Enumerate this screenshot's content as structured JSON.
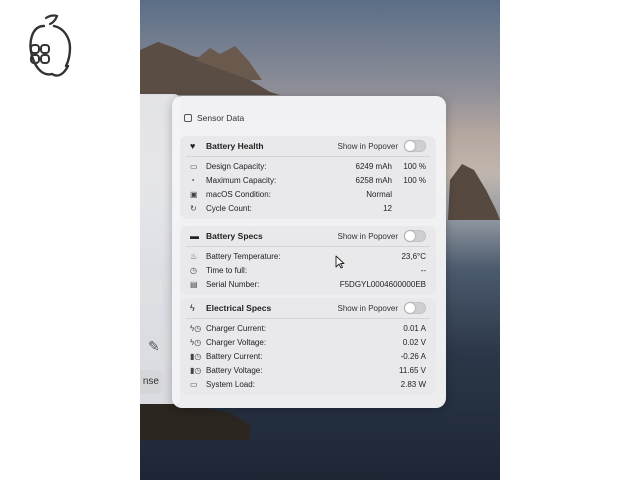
{
  "colors": {
    "panel_bg": "#f4f4f6",
    "card_bg": "#e9e9ec",
    "toggle_off": "#cfcfd3"
  },
  "back_window": {
    "button_label": "nse"
  },
  "panel": {
    "title": "Sensor Data",
    "sections": [
      {
        "title": "Battery Health",
        "icon": "heart-icon",
        "popover_label": "Show in Popover",
        "popover_enabled": false,
        "rows": [
          {
            "icon": "battery-icon",
            "label": "Design Capacity:",
            "value": "6249 mAh",
            "extra": "100 %"
          },
          {
            "icon": "battery-gear-icon",
            "label": "Maximum Capacity:",
            "value": "6258 mAh",
            "extra": "100 %"
          },
          {
            "icon": "shield-icon",
            "label": "macOS Condition:",
            "value": "Normal",
            "extra": ""
          },
          {
            "icon": "cycle-icon",
            "label": "Cycle Count:",
            "value": "12",
            "extra": ""
          }
        ]
      },
      {
        "title": "Battery Specs",
        "icon": "battery-icon",
        "popover_label": "Show in Popover",
        "popover_enabled": false,
        "rows": [
          {
            "icon": "thermometer-icon",
            "label": "Battery Temperature:",
            "value": "23,6°C",
            "extra": ""
          },
          {
            "icon": "clock-icon",
            "label": "Time to full:",
            "value": "--",
            "extra": ""
          },
          {
            "icon": "document-icon",
            "label": "Serial Number:",
            "value": "F5DGYL0004600000EB",
            "extra": ""
          }
        ]
      },
      {
        "title": "Electrical Specs",
        "icon": "bolt-icon",
        "popover_label": "Show in Popover",
        "popover_enabled": false,
        "rows": [
          {
            "icon": "bolt-gauge-icon",
            "label": "Charger Current:",
            "value": "0.01 A",
            "extra": ""
          },
          {
            "icon": "bolt-gauge-icon",
            "label": "Charger Voltage:",
            "value": "0.02 V",
            "extra": ""
          },
          {
            "icon": "battery-gauge-icon",
            "label": "Battery Current:",
            "value": "-0.26 A",
            "extra": ""
          },
          {
            "icon": "battery-gauge-icon",
            "label": "Battery Voltage:",
            "value": "11.65 V",
            "extra": ""
          },
          {
            "icon": "laptop-icon",
            "label": "System Load:",
            "value": "2.83 W",
            "extra": ""
          }
        ]
      }
    ]
  }
}
